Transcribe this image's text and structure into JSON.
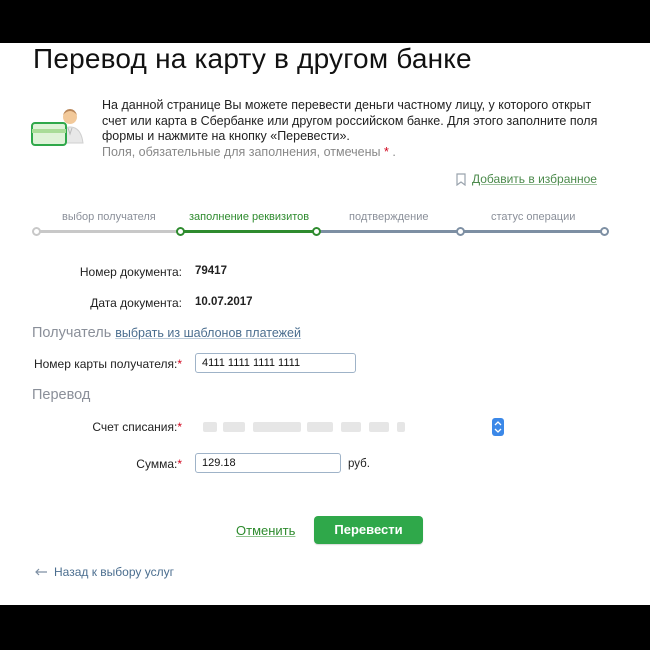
{
  "page": {
    "title": "Перевод на карту в другом банке",
    "intro_text": "На данной странице Вы можете перевести деньги частному лицу, у которого открыт счет или карта в Сбербанке или другом российском банке. Для этого заполните поля формы и нажмите на кнопку «Перевести».",
    "required_note": "Поля, обязательные для заполнения, отмечены",
    "required_star": "*",
    "required_dot": ".",
    "favorite_label": "Добавить в избранное"
  },
  "steps": [
    {
      "label": "выбор получателя",
      "state": "done"
    },
    {
      "label": "заполнение реквизитов",
      "state": "active"
    },
    {
      "label": "подтверждение",
      "state": "pending"
    },
    {
      "label": "статус операции",
      "state": "pending"
    }
  ],
  "document": {
    "number_label": "Номер документа:",
    "number_value": "79417",
    "date_label": "Дата документа:",
    "date_value": "10.07.2017"
  },
  "recipient": {
    "section_title": "Получатель",
    "templates_link": "выбрать из шаблонов платежей",
    "card_label": "Номер карты получателя:",
    "card_value": "4111 1111 1111 1111"
  },
  "transfer": {
    "section_title": "Перевод",
    "account_label": "Счет списания:",
    "amount_label": "Сумма:",
    "amount_value": "129.18",
    "currency": "руб."
  },
  "required_mark": "*",
  "actions": {
    "cancel_label": "Отменить",
    "submit_label": "Перевести",
    "back_label": "Назад к выбору услуг"
  },
  "colors": {
    "accent_green": "#2fa84a",
    "link_blue": "#4b6e8f",
    "required_red": "#d0021b",
    "step_done": "#c4c4c4",
    "step_active": "#2e8b2e",
    "step_pending": "#7d8fa3"
  },
  "icons": {
    "intro": "user-card-icon",
    "favorite": "bookmark-icon",
    "back": "arrow-left-icon",
    "select": "chevron-updown-icon"
  }
}
